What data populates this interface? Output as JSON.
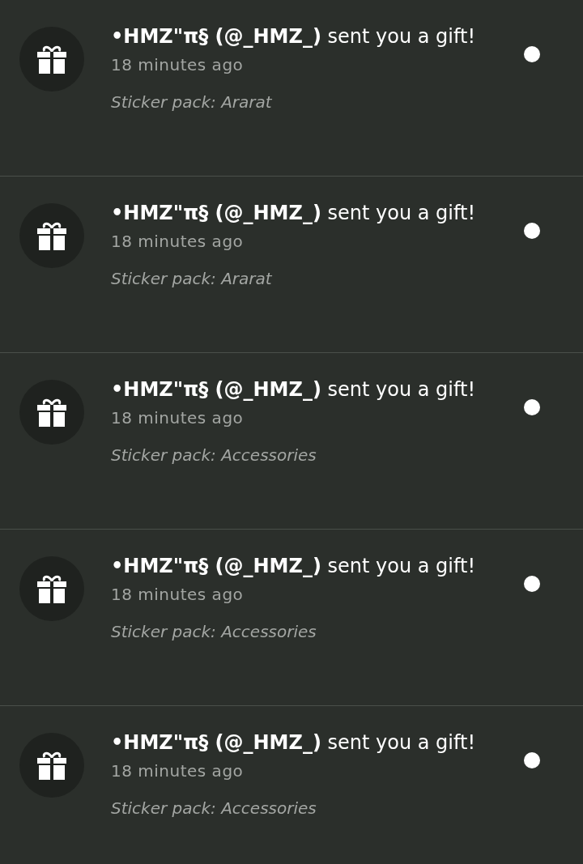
{
  "notifications": [
    {
      "message": "**•HMZ\"π§ (@_HMZ_)** sent you a gift!",
      "time": "18 minutes ago",
      "detail": "Sticker pack: Ararat",
      "unread": true
    },
    {
      "message": "**•HMZ\"π§ (@_HMZ_)** sent you a gift!",
      "time": "18 minutes ago",
      "detail": "Sticker pack: Ararat",
      "unread": true
    },
    {
      "message": "**•HMZ\"π§ (@_HMZ_)** sent you a gift!",
      "time": "18 minutes ago",
      "detail": "Sticker pack: Accessories",
      "unread": true
    },
    {
      "message": "**•HMZ\"π§ (@_HMZ_)** sent you a gift!",
      "time": "18 minutes ago",
      "detail": "Sticker pack: Accessories",
      "unread": true
    },
    {
      "message": "**•HMZ\"π§ (@_HMZ_)** sent you a gift!",
      "time": "18 minutes ago",
      "detail": "Sticker pack: Accessories",
      "unread": true
    }
  ]
}
